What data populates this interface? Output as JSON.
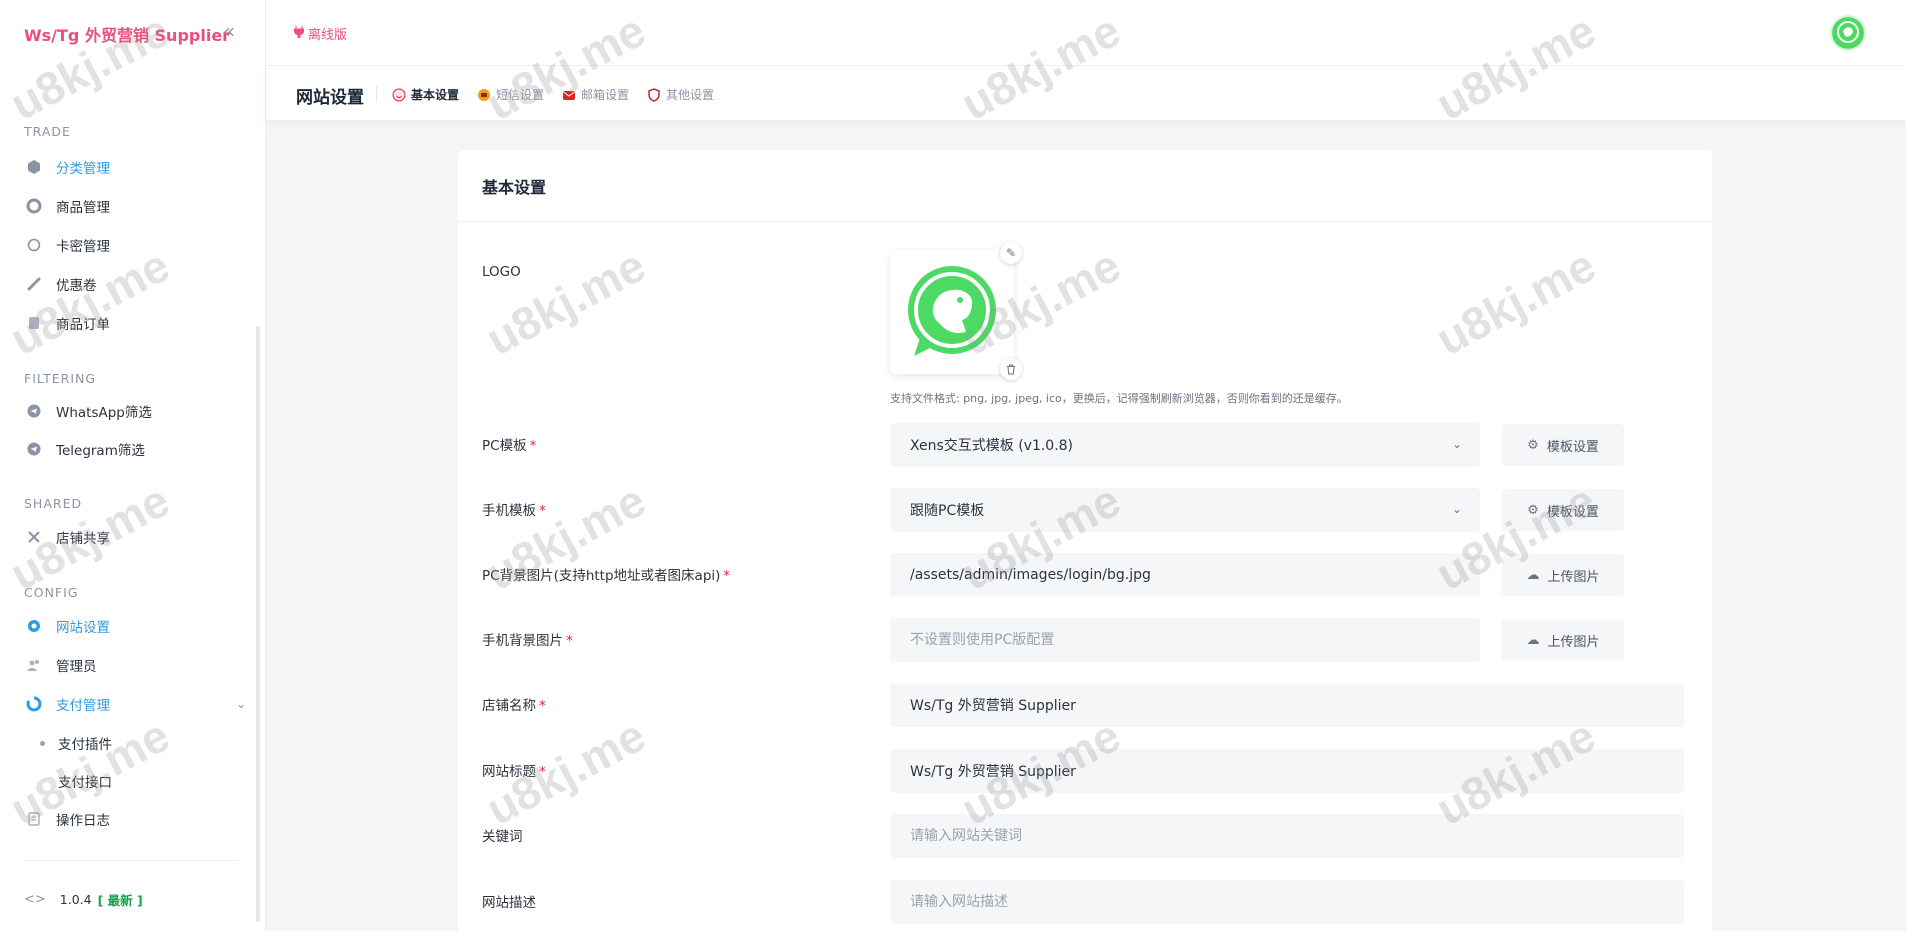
{
  "brand": {
    "name": "Ws/Tg 外贸营销 Supplier"
  },
  "sidebar": {
    "collapse_icon": "double-chevron-left-icon",
    "sections": [
      {
        "title": "TRADE",
        "items": [
          {
            "label": "分类管理",
            "icon": "cube-icon",
            "active": true
          },
          {
            "label": "商品管理",
            "icon": "refresh-icon"
          },
          {
            "label": "卡密管理",
            "icon": "circle-icon"
          },
          {
            "label": "优惠卷",
            "icon": "link-icon"
          },
          {
            "label": "商品订单",
            "icon": "order-icon"
          }
        ]
      },
      {
        "title": "FILTERING",
        "items": [
          {
            "label": "WhatsApp筛选",
            "icon": "telegram-icon"
          },
          {
            "label": "Telegram筛选",
            "icon": "telegram-icon"
          }
        ]
      },
      {
        "title": "SHARED",
        "items": [
          {
            "label": "店铺共享",
            "icon": "share-icon"
          }
        ]
      },
      {
        "title": "CONFIG",
        "items": [
          {
            "label": "网站设置",
            "icon": "gear-icon",
            "active": true
          },
          {
            "label": "管理员",
            "icon": "users-icon"
          },
          {
            "label": "支付管理",
            "icon": "pay-icon",
            "active": true,
            "expanded": true,
            "children": [
              {
                "label": "支付插件"
              },
              {
                "label": "支付接口"
              }
            ]
          },
          {
            "label": "操作日志",
            "icon": "log-icon"
          }
        ]
      }
    ],
    "version": {
      "number": "1.0.4",
      "tag": "[ 最新 ]"
    }
  },
  "topbar": {
    "offline_label": "离线版",
    "avatar_icon": "logo-avatar"
  },
  "page": {
    "title": "网站设置",
    "tabs": [
      {
        "label": "基本设置",
        "active": true
      },
      {
        "label": "短信设置"
      },
      {
        "label": "邮箱设置"
      },
      {
        "label": "其他设置"
      }
    ]
  },
  "form": {
    "title": "基本设置",
    "logo": {
      "label": "LOGO",
      "hint": "支持文件格式: png, jpg, jpeg, ico，更换后，记得强制刷新浏览器，否则你看到的还是缓存。"
    },
    "pc_template": {
      "label": "PC模板",
      "value": "Xens交互式模板 (v1.0.8)",
      "button": "模板设置"
    },
    "mobile_template": {
      "label": "手机模板",
      "value": "跟随PC模板",
      "button": "模板设置"
    },
    "pc_bg": {
      "label": "PC背景图片(支持http地址或者图床api)",
      "value": "/assets/admin/images/login/bg.jpg",
      "button": "上传图片"
    },
    "mobile_bg": {
      "label": "手机背景图片",
      "placeholder": "不设置则使用PC版配置",
      "button": "上传图片"
    },
    "shop_name": {
      "label": "店铺名称",
      "value": "Ws/Tg 外贸营销 Supplier"
    },
    "site_title": {
      "label": "网站标题",
      "value": "Ws/Tg 外贸营销 Supplier"
    },
    "keywords": {
      "label": "关键词",
      "placeholder": "请输入网站关键词"
    },
    "description": {
      "label": "网站描述",
      "placeholder": "请输入网站描述"
    },
    "required_mark": "*"
  },
  "colors": {
    "accent": "#2f9ce3",
    "brand": "#ec4f7a",
    "required": "#e11d48",
    "latest": "#16a34a",
    "logo_green": "#4cd964"
  },
  "watermark": {
    "text": "u8kj.me"
  }
}
